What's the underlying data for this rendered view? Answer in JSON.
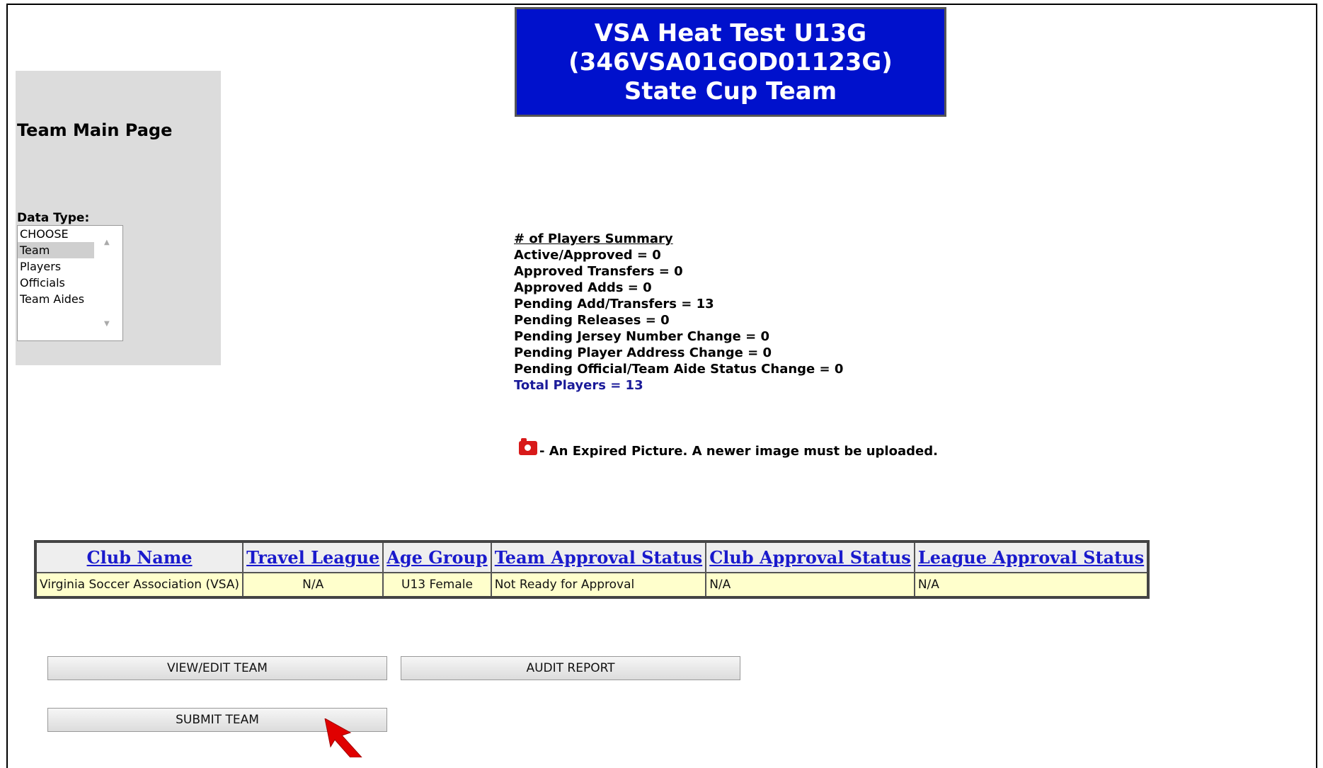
{
  "banner": {
    "line1": "VSA Heat Test U13G",
    "line2": "(346VSA01GOD01123G)",
    "line3": "State Cup Team"
  },
  "sidebar": {
    "title": "Team Main Page",
    "data_type_label": "Data Type:",
    "options": [
      "CHOOSE",
      "Team",
      "Players",
      "Officials",
      "Team Aides"
    ],
    "selected": "Team"
  },
  "summary": {
    "heading": "# of Players Summary",
    "lines": [
      "Active/Approved = 0",
      "Approved Transfers = 0",
      "Approved Adds = 0",
      "Pending Add/Transfers = 13",
      "Pending Releases = 0",
      "Pending Jersey Number Change = 0",
      "Pending Player Address Change = 0",
      "Pending Official/Team Aide Status Change = 0"
    ],
    "total": "Total Players = 13"
  },
  "legend": {
    "text": "- An Expired Picture. A newer image must be uploaded.",
    "icon": "camera-icon"
  },
  "table": {
    "headers": [
      "Club Name",
      "Travel League",
      "Age Group",
      "Team Approval Status",
      "Club Approval Status",
      "League Approval Status"
    ],
    "row": [
      "Virginia Soccer Association (VSA)",
      "N/A",
      "U13 Female",
      "Not Ready for Approval",
      "N/A",
      "N/A"
    ]
  },
  "buttons": {
    "view_edit": "VIEW/EDIT TEAM",
    "audit": "AUDIT REPORT",
    "submit": "SUBMIT TEAM"
  },
  "colors": {
    "banner": "#0011cc",
    "table_row": "#ffffcc",
    "arrow": "#e00000"
  }
}
